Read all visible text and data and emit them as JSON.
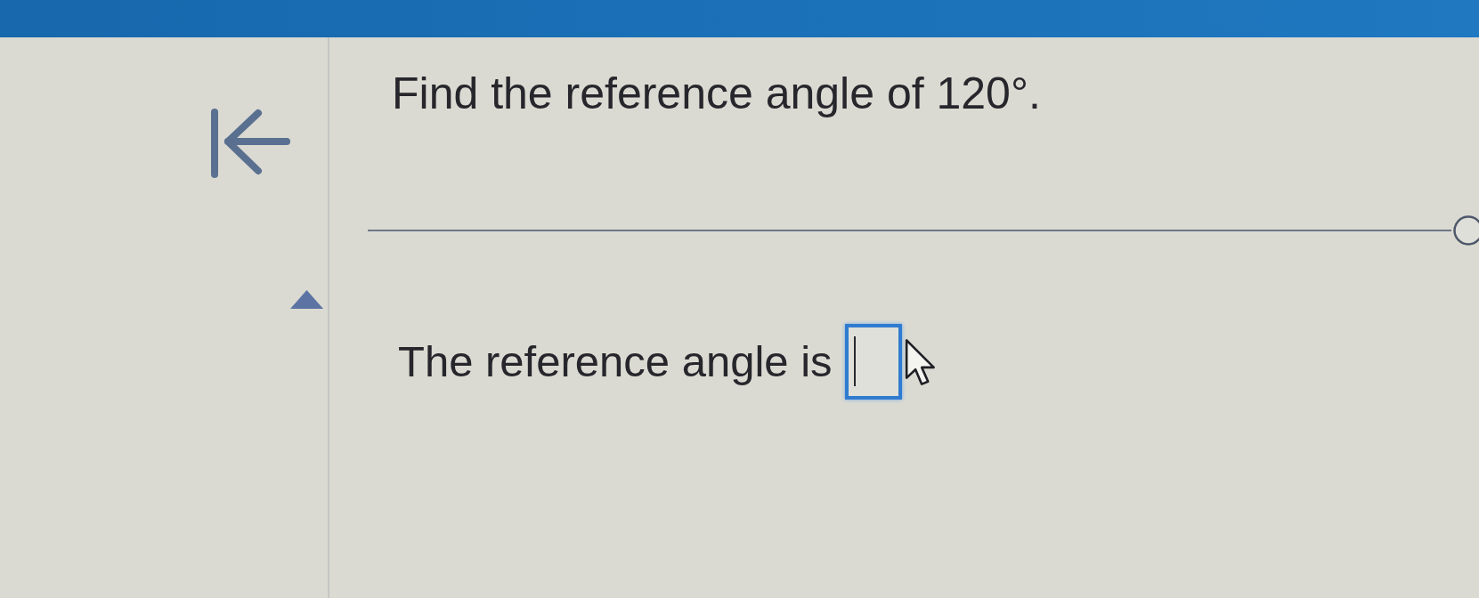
{
  "question": {
    "text": "Find the reference angle of 120°."
  },
  "answer": {
    "prompt": "The reference angle is",
    "focused": true
  }
}
